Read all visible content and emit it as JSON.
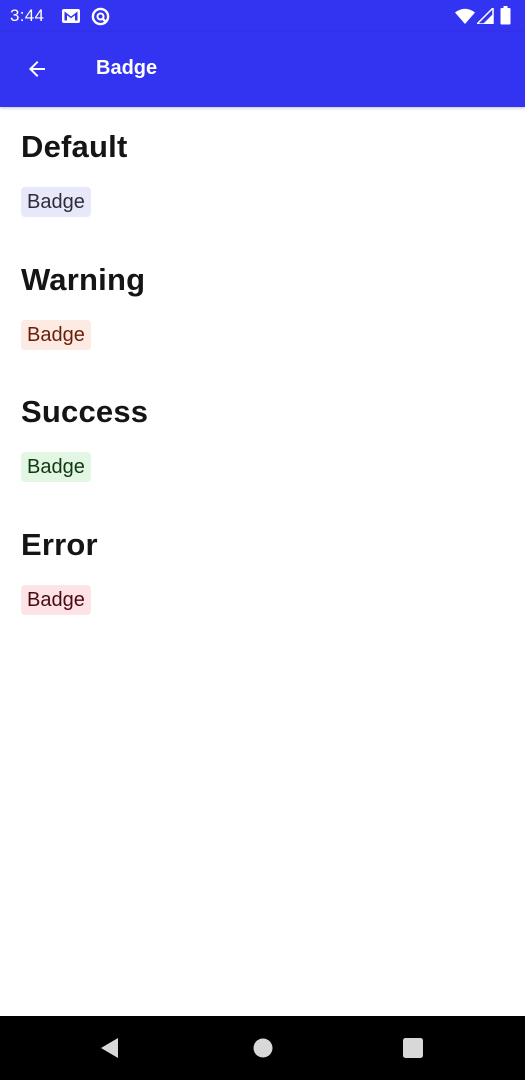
{
  "status_bar": {
    "time": "3:44",
    "icons": [
      "gmail-icon",
      "vpn-icon",
      "wifi-icon",
      "signal-icon",
      "battery-icon"
    ]
  },
  "app_bar": {
    "title": "Badge",
    "back_icon": "arrow-back-icon"
  },
  "sections": [
    {
      "heading": "Default",
      "badge": "Badge",
      "status": "default"
    },
    {
      "heading": "Warning",
      "badge": "Badge",
      "status": "warning"
    },
    {
      "heading": "Success",
      "badge": "Badge",
      "status": "success"
    },
    {
      "heading": "Error",
      "badge": "Badge",
      "status": "error"
    }
  ],
  "colors": {
    "primary": "#3333f2",
    "default_bg": "#e8e8fb",
    "warning_bg": "#fdebe3",
    "success_bg": "#e3f5e3",
    "error_bg": "#fde3e6"
  },
  "nav_bar": {
    "buttons": [
      "back-triangle-icon",
      "home-circle-icon",
      "recents-square-icon"
    ]
  }
}
